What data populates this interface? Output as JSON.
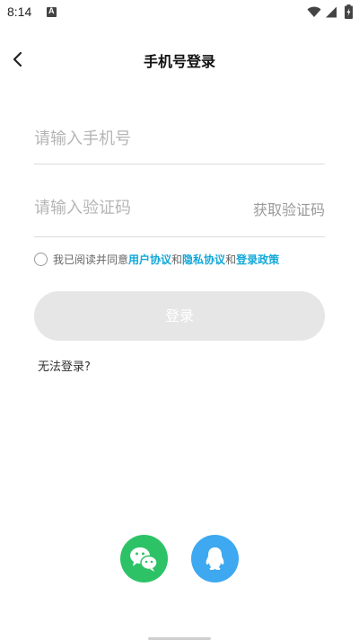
{
  "status_bar": {
    "time": "8:14",
    "notification_icon": "A"
  },
  "header": {
    "back_icon": "chevron-left-icon",
    "title": "手机号登录"
  },
  "form": {
    "phone_placeholder": "请输入手机号",
    "phone_value": "",
    "code_placeholder": "请输入验证码",
    "code_value": "",
    "get_code_label": "获取验证码"
  },
  "agreement": {
    "checked": false,
    "prefix": "我已阅读并同意",
    "user_agreement": "用户协议",
    "and_1": "和",
    "privacy_agreement": "隐私协议",
    "and_2": "和",
    "login_policy": "登录政策"
  },
  "login_button": {
    "label": "登录",
    "enabled": false
  },
  "cannot_login_label": "无法登录?",
  "social_login": [
    {
      "name": "wechat",
      "icon": "wechat-icon",
      "color": "#2ec267"
    },
    {
      "name": "qq",
      "icon": "qq-icon",
      "color": "#3ea8f0"
    }
  ],
  "colors": {
    "link": "#12a8d8",
    "button_disabled_bg": "#e6e6e6",
    "placeholder": "#b5b5b5"
  }
}
